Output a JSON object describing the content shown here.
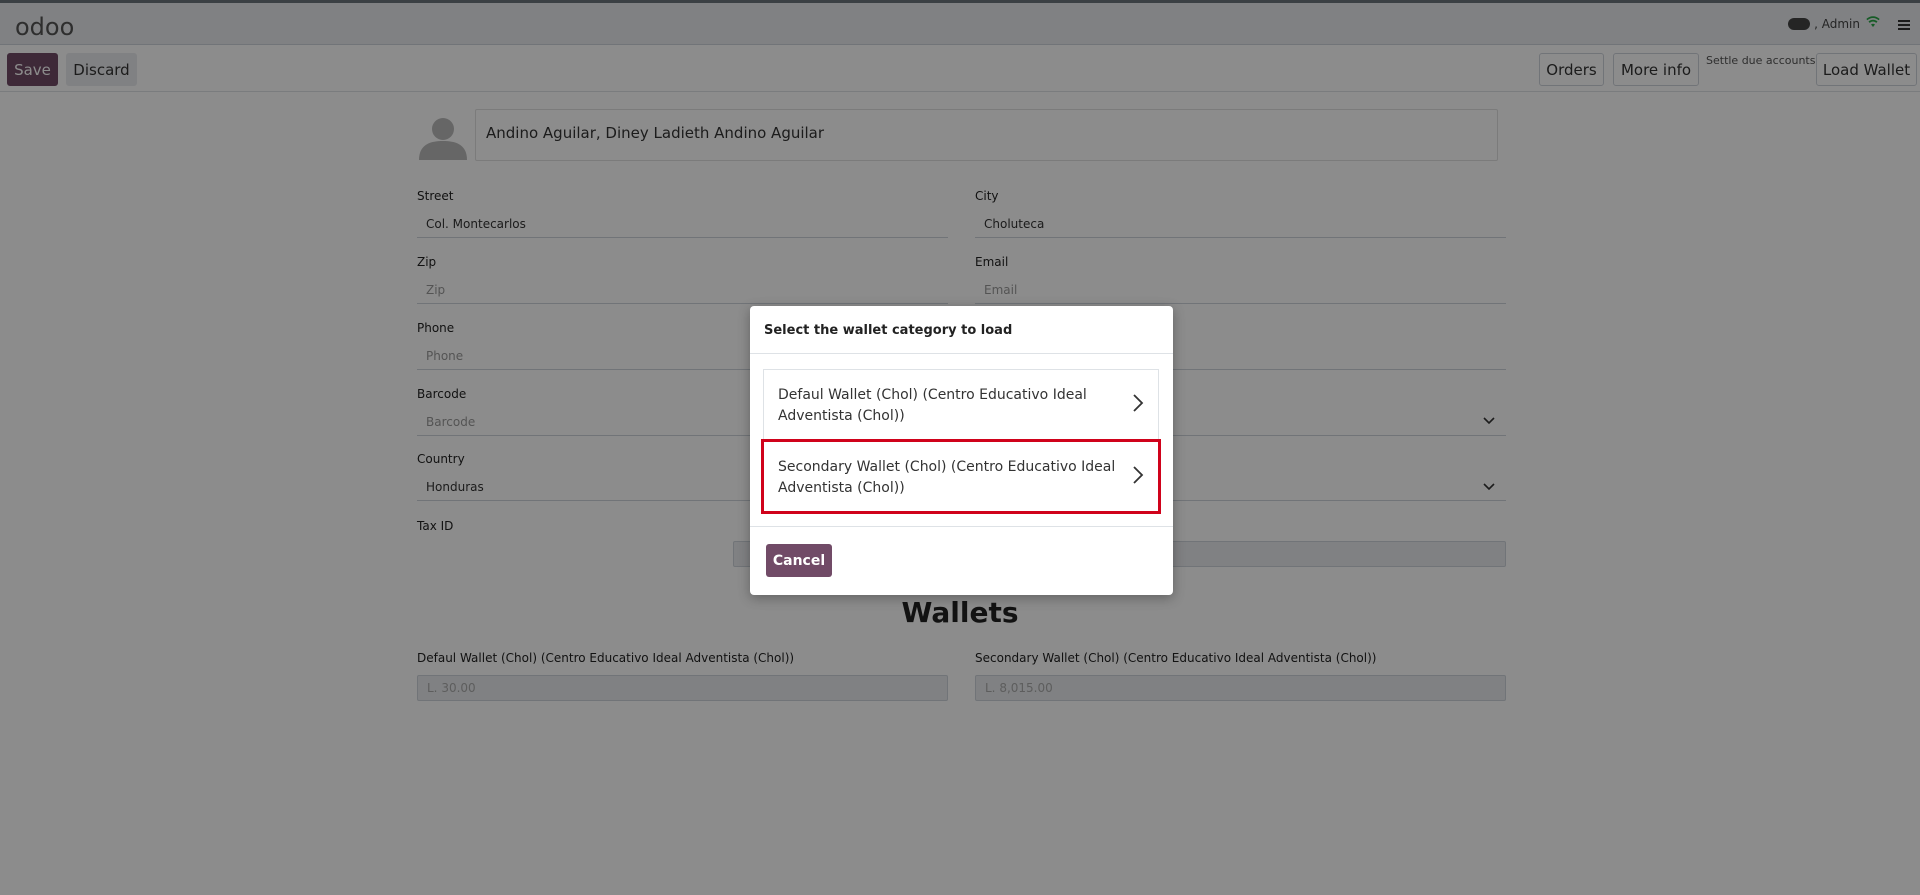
{
  "topbar": {
    "logo": "odoo",
    "user": ", Admin"
  },
  "controlbar": {
    "save": "Save",
    "discard": "Discard",
    "orders": "Orders",
    "more_info": "More info",
    "settle": "Settle due accounts",
    "load_wallet": "Load Wallet"
  },
  "form": {
    "name": "Andino Aguilar, Diney Ladieth Andino Aguilar",
    "street_label": "Street",
    "street_value": "Col. Montecarlos",
    "city_label": "City",
    "city_value": "Choluteca",
    "zip_label": "Zip",
    "zip_placeholder": "Zip",
    "email_label": "Email",
    "email_placeholder": "Email",
    "phone_label": "Phone",
    "phone_placeholder": "Phone",
    "barcode_label": "Barcode",
    "barcode_placeholder": "Barcode",
    "country_label": "Country",
    "country_value": "Honduras",
    "taxid_label": "Tax ID",
    "wallets_title": "Wallets",
    "wallets": [
      {
        "label": "Defaul Wallet (Chol) (Centro Educativo Ideal Adventista (Chol))",
        "value": "L. 30.00"
      },
      {
        "label": "Secondary Wallet (Chol) (Centro Educativo Ideal Adventista (Chol))",
        "value": "L. 8,015.00"
      }
    ]
  },
  "modal": {
    "title": "Select the wallet category to load",
    "options": [
      {
        "label": "Defaul Wallet (Chol) (Centro Educativo Ideal Adventista (Chol))"
      },
      {
        "label": "Secondary Wallet (Chol) (Centro Educativo Ideal Adventista (Chol))"
      }
    ],
    "cancel": "Cancel"
  },
  "colors": {
    "brand": "#714b67",
    "highlight": "#d0021b"
  }
}
